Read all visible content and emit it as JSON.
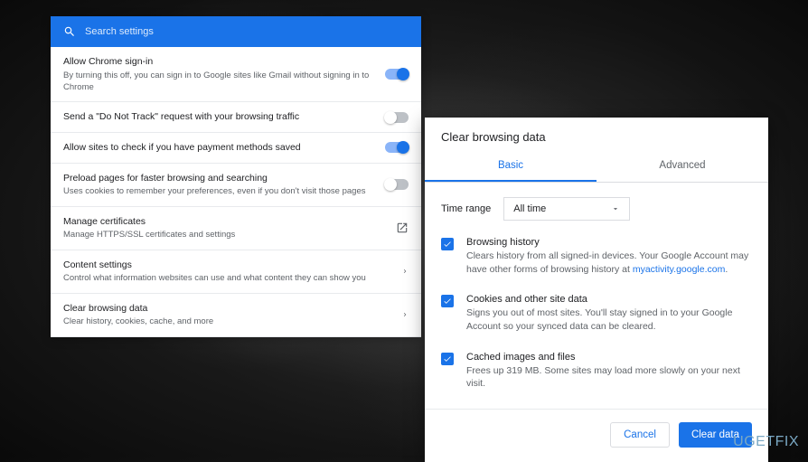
{
  "settings": {
    "search_placeholder": "Search settings",
    "rows": [
      {
        "title": "Allow Chrome sign-in",
        "desc": "By turning this off, you can sign in to Google sites like Gmail without signing in to Chrome",
        "control": "toggle",
        "state": "on"
      },
      {
        "title": "Send a \"Do Not Track\" request with your browsing traffic",
        "desc": "",
        "control": "toggle",
        "state": "off"
      },
      {
        "title": "Allow sites to check if you have payment methods saved",
        "desc": "",
        "control": "toggle",
        "state": "on"
      },
      {
        "title": "Preload pages for faster browsing and searching",
        "desc": "Uses cookies to remember your preferences, even if you don't visit those pages",
        "control": "toggle",
        "state": "off"
      },
      {
        "title": "Manage certificates",
        "desc": "Manage HTTPS/SSL certificates and settings",
        "control": "external"
      },
      {
        "title": "Content settings",
        "desc": "Control what information websites can use and what content they can show you",
        "control": "arrow"
      },
      {
        "title": "Clear browsing data",
        "desc": "Clear history, cookies, cache, and more",
        "control": "arrow"
      }
    ]
  },
  "dialog": {
    "title": "Clear browsing data",
    "tabs": {
      "basic": "Basic",
      "advanced": "Advanced"
    },
    "time_range_label": "Time range",
    "time_range_value": "All time",
    "items": [
      {
        "title": "Browsing history",
        "desc_before": "Clears history from all signed-in devices. Your Google Account may have other forms of browsing history at ",
        "link": "myactivity.google.com",
        "desc_after": "."
      },
      {
        "title": "Cookies and other site data",
        "desc": "Signs you out of most sites. You'll stay signed in to your Google Account so your synced data can be cleared."
      },
      {
        "title": "Cached images and files",
        "desc": "Frees up 319 MB. Some sites may load more slowly on your next visit."
      }
    ],
    "cancel": "Cancel",
    "clear": "Clear data"
  },
  "watermark": "UGETFIX"
}
